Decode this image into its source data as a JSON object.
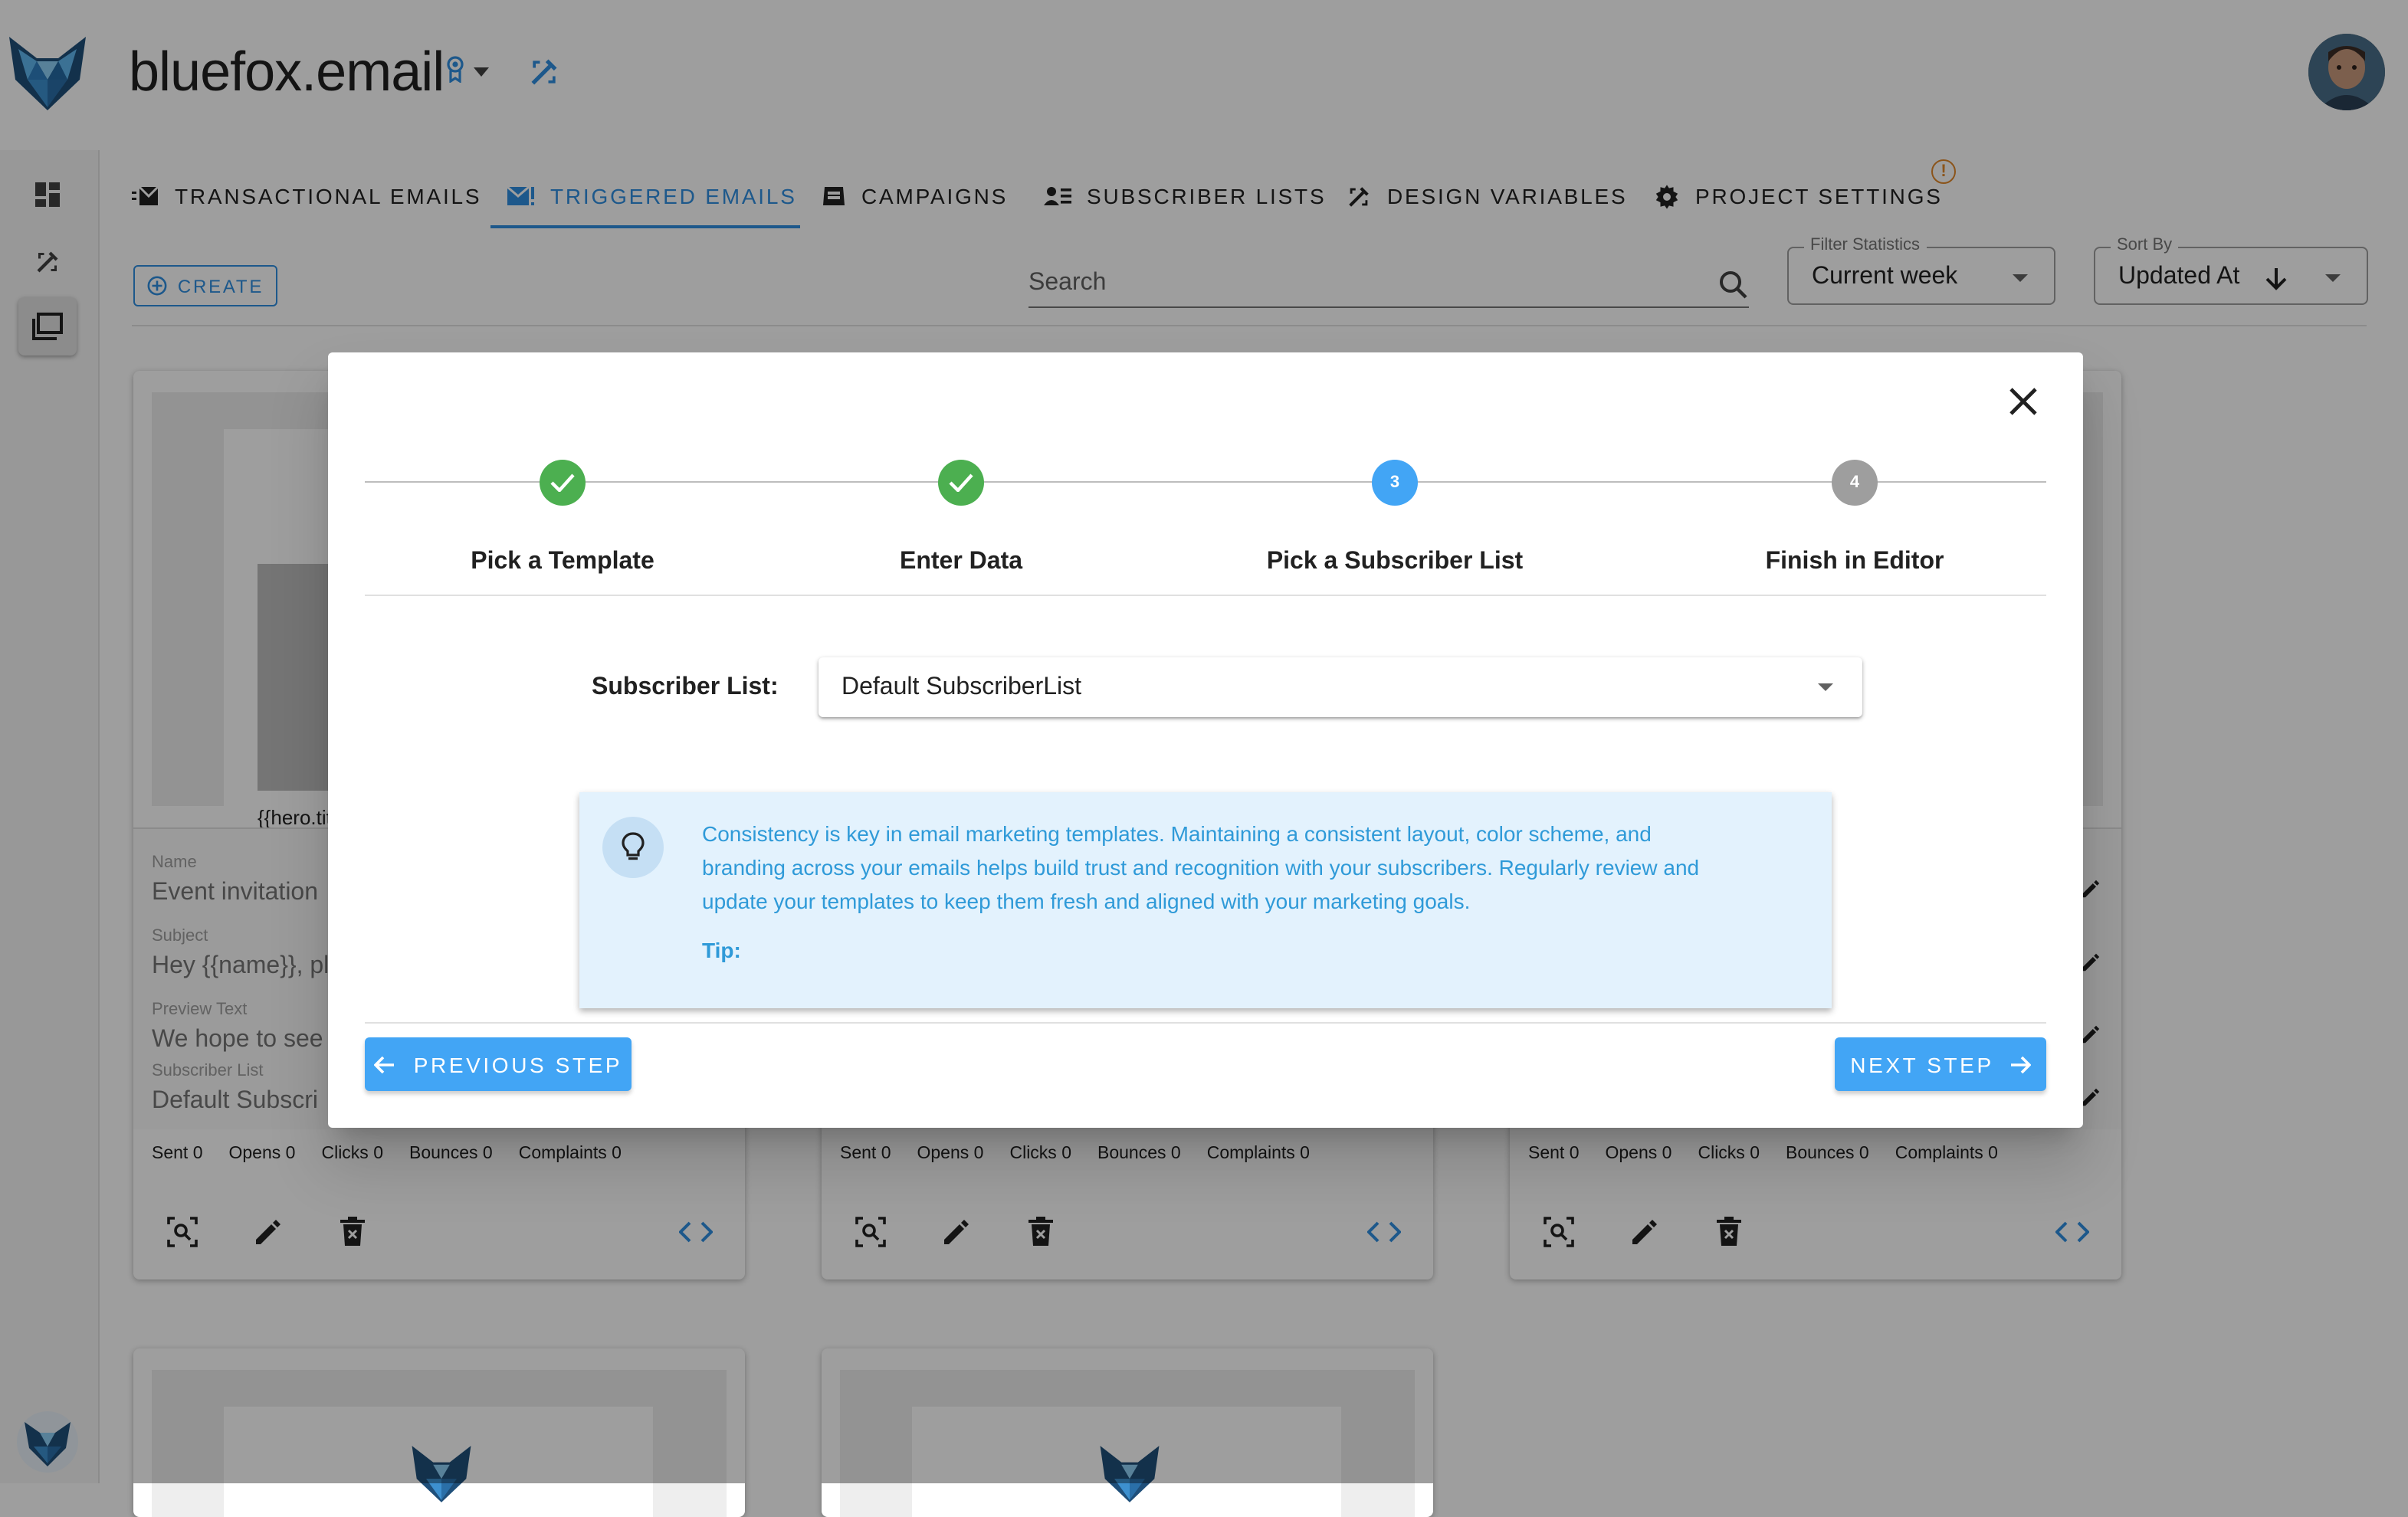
{
  "app": {
    "project_name": "bluefox.email",
    "user_avatar": "user-avatar",
    "warning_badge": "!"
  },
  "nav_tabs": [
    {
      "label": "Transactional Emails",
      "icon": "mail-lines-icon",
      "active": false
    },
    {
      "label": "Triggered Emails",
      "icon": "mail-alert-icon",
      "active": true
    },
    {
      "label": "Campaigns",
      "icon": "mailbox-icon",
      "active": false
    },
    {
      "label": "Subscriber Lists",
      "icon": "subscriber-list-icon",
      "active": false
    },
    {
      "label": "Design Variables",
      "icon": "design-tools-icon",
      "active": false
    },
    {
      "label": "Project Settings",
      "icon": "gear-icon",
      "active": false
    }
  ],
  "toolbar": {
    "create_label": "CREATE",
    "search_placeholder": "Search",
    "filter_label": "Filter Statistics",
    "filter_value": "Current week",
    "sort_label": "Sort By",
    "sort_value": "Updated At"
  },
  "cards": [
    {
      "hero_text": "{{hero.titl",
      "name_label": "Name",
      "name_value": "Event invitation",
      "subject_label": "Subject",
      "subject_value": "Hey {{name}}, pl",
      "preview_label": "Preview Text",
      "preview_value": "We hope to see",
      "list_label": "Subscriber List",
      "list_value": "Default Subscri"
    }
  ],
  "card_stats": {
    "sent": "Sent 0",
    "opens": "Opens 0",
    "clicks": "Clicks 0",
    "bounces": "Bounces 0",
    "complaints": "Complaints 0"
  },
  "modal": {
    "steps": [
      {
        "label": "Pick a Template",
        "number": "1",
        "status": "complete"
      },
      {
        "label": "Enter Data",
        "number": "2",
        "status": "complete"
      },
      {
        "label": "Pick a Subscriber List",
        "number": "3",
        "status": "current"
      },
      {
        "label": "Finish in Editor",
        "number": "4",
        "status": "upcoming"
      }
    ],
    "subscriber_list_label": "Subscriber List:",
    "subscriber_list_value": "Default SubscriberList",
    "tip_text": "Consistency is key in email marketing templates. Maintaining a consistent layout, color scheme, and branding across your emails helps build trust and recognition with your subscribers. Regularly review and update your templates to keep them fresh and aligned with your marketing goals.",
    "tip_label": "Tip:",
    "prev_label": "PREVIOUS STEP",
    "next_label": "NEXT STEP"
  },
  "colors": {
    "accent": "#2f8fe0",
    "button": "#42a5f5",
    "step_complete": "#4caf50",
    "step_current": "#42a5f5",
    "step_upcoming": "#9e9e9e",
    "tip_background": "#e3f2fd",
    "tip_text": "#2f9ad8",
    "warning": "#e0882a"
  }
}
